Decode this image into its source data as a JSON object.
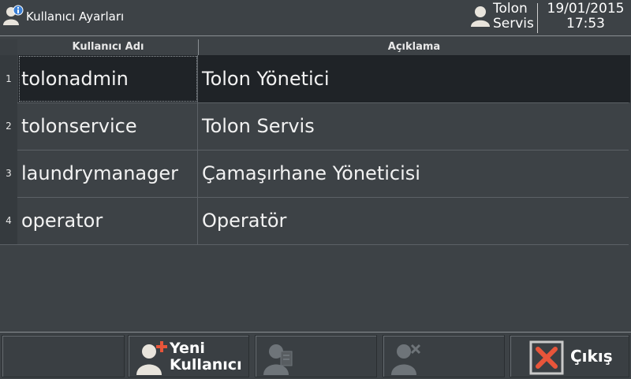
{
  "window": {
    "title": "Kullanıcı Ayarları",
    "user_line1": "Tolon",
    "user_line2": "Servis",
    "date": "19/01/2015",
    "time": "17:53"
  },
  "table": {
    "columns": [
      "Kullanıcı Adı",
      "Açıklama"
    ],
    "rows": [
      {
        "num": "1",
        "username": "tolonadmin",
        "description": "Tolon Yönetici",
        "selected": true
      },
      {
        "num": "2",
        "username": "tolonservice",
        "description": "Tolon Servis",
        "selected": false
      },
      {
        "num": "3",
        "username": "laundrymanager",
        "description": "Çamaşırhane Yöneticisi",
        "selected": false
      },
      {
        "num": "4",
        "username": "operator",
        "description": "Operatör",
        "selected": false
      }
    ]
  },
  "toolbar": {
    "new_user_line1": "Yeni",
    "new_user_line2": "Kullanıcı",
    "exit_label": "Çıkış"
  },
  "colors": {
    "background": "#3d4246",
    "selected_row": "#1f2327",
    "accent_red": "#e8553a",
    "text": "#f2f2f2"
  },
  "icons": {
    "app": "user-info-icon",
    "current_user": "user-icon",
    "new_user": "user-add-icon",
    "edit_user": "user-edit-icon",
    "delete_user": "user-delete-icon",
    "exit": "close-x-icon"
  }
}
